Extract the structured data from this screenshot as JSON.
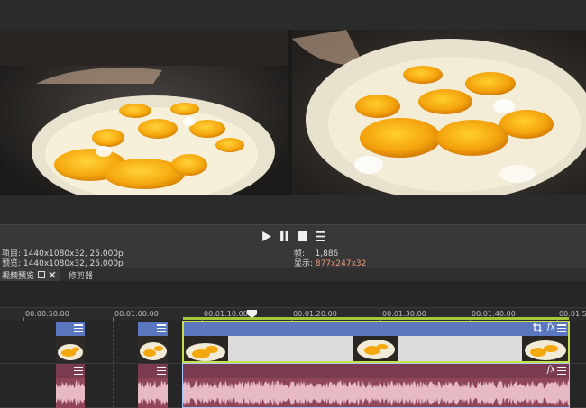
{
  "transport": {
    "play_icon": "play-icon",
    "pause_icon": "pause-icon",
    "stop_icon": "stop-icon",
    "menu_icon": "menu-icon"
  },
  "info": {
    "project_label": "项目:",
    "project_value": "1440x1080x32, 25.000p",
    "preview_label": "预览:",
    "preview_value": "1440x1080x32, 25.000p",
    "frame_label": "帧:",
    "frame_value": "1,886",
    "display_label": "显示:",
    "display_value": "877x247x32"
  },
  "tabs": {
    "video_preview": "视频预览",
    "trimmer": "修剪器"
  },
  "ruler": {
    "labels": [
      "00:00:50:00",
      "00:01:00:00",
      "00:01:10:00",
      "00:01:20:00",
      "00:01:30:00",
      "00:01:40:00",
      "00:01:5"
    ]
  },
  "colors": {
    "video_clip_header": "#5b77c0",
    "audio_clip_header": "#7a3a4f",
    "audio_clip_body": "#8e4658",
    "selection": "#c8de4a",
    "display_value": "#e99a7b"
  },
  "icons": {
    "crop": "crop-icon",
    "fx": "fx-icon",
    "clip_menu": "menu-icon"
  }
}
